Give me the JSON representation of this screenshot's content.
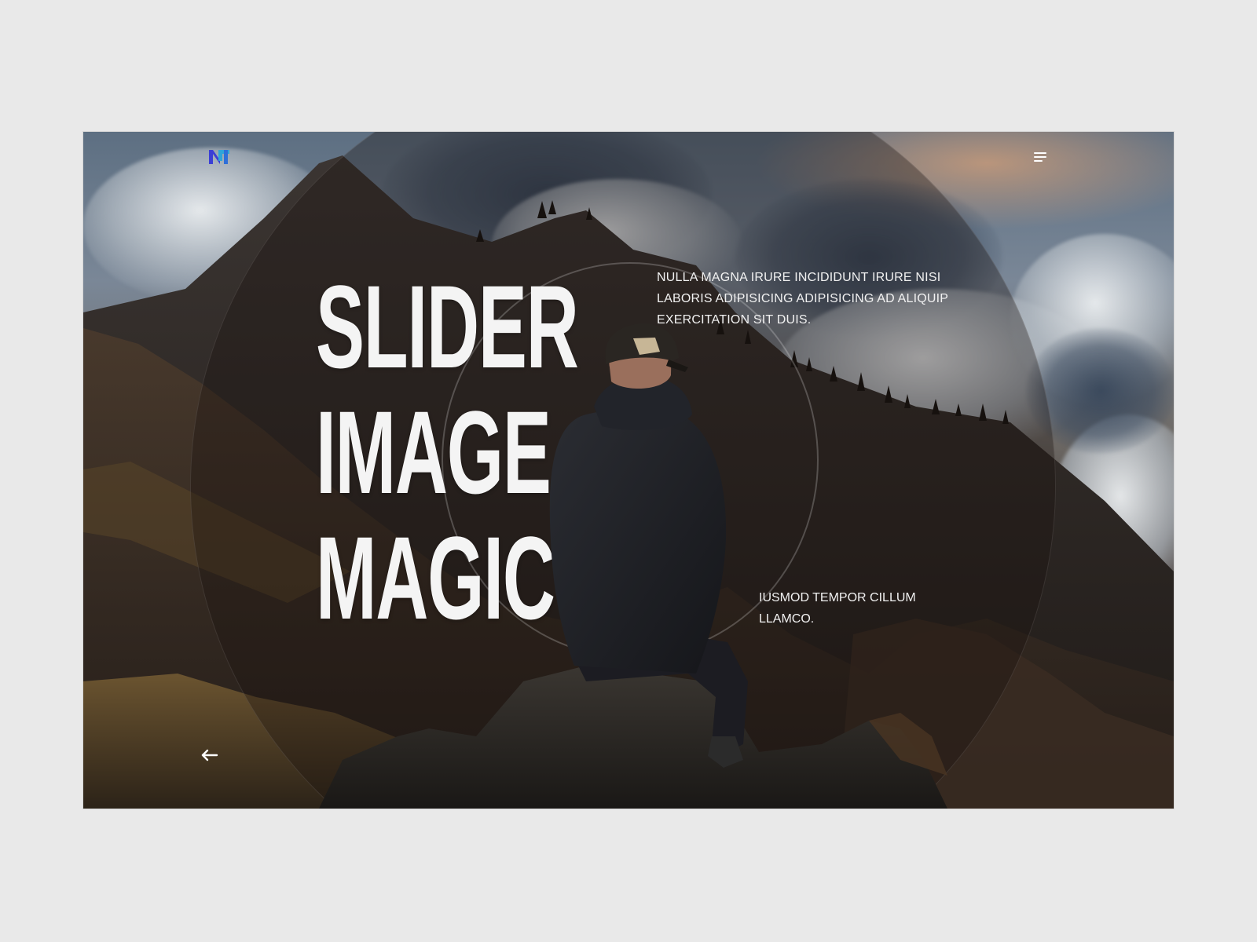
{
  "slide": {
    "headline_lines": [
      "SLIDER",
      "IMAGE",
      "MAGIC"
    ],
    "description_top": "NULLA MAGNA IRURE INCIDIDUNT IRURE NISI LABORIS ADIPISICING ADIPISICING AD ALIQUIP EXERCITATION SIT DUIS.",
    "description_bottom_line1": "IUSMOD TEMPOR CILLUM",
    "description_bottom_line2": "LLAMCO."
  },
  "icons": {
    "logo": "logo-icon",
    "menu": "hamburger-menu-icon",
    "prev": "arrow-left-icon"
  },
  "colors": {
    "page_background": "#e9e9e9",
    "text": "#f4f4f4",
    "logo_primary": "#3b3fd6",
    "logo_secondary": "#2fa6d8"
  }
}
